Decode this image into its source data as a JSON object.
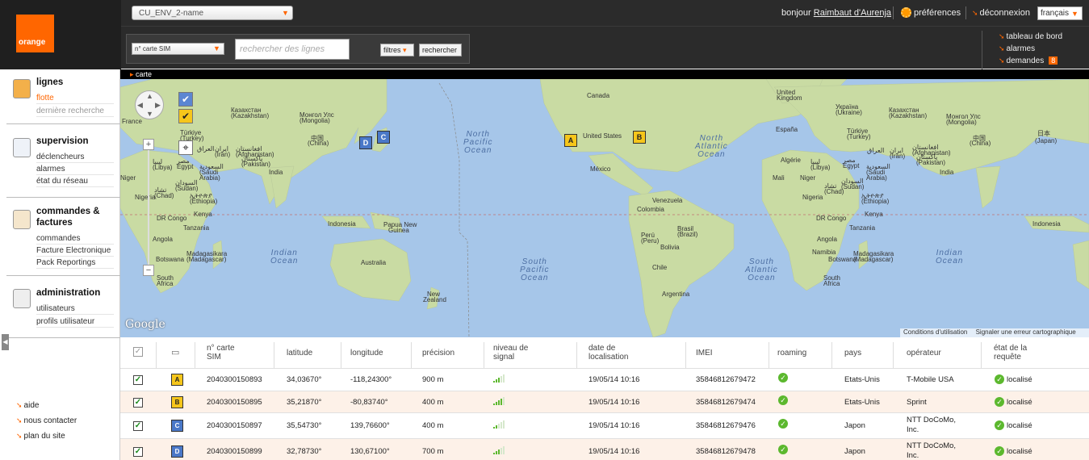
{
  "header": {
    "logo": "orange",
    "environment": "CU_ENV_2-name",
    "greeting_prefix": "bonjour",
    "user_name": "Raimbaut d'Aurenja",
    "preferences": "préférences",
    "logout": "déconnexion",
    "language": "français"
  },
  "search": {
    "field_select": "n° carte SIM",
    "placeholder": "rechercher des lignes",
    "filters_label": "filtres",
    "search_label": "rechercher"
  },
  "quicklinks": {
    "dashboard": "tableau de bord",
    "alarms": "alarmes",
    "requests": "demandes",
    "requests_count": "8"
  },
  "sidebar": {
    "sections": [
      {
        "title": "lignes",
        "items": [
          "flotte",
          "dernière recherche"
        ]
      },
      {
        "title": "supervision",
        "items": [
          "déclencheurs",
          "alarmes",
          "état du réseau"
        ]
      },
      {
        "title": "commandes &",
        "title2": "factures",
        "items": [
          "commandes",
          "Facture Electronique",
          "Pack Reportings"
        ]
      },
      {
        "title": "administration",
        "items": [
          "utilisateurs",
          "profils utilisateur"
        ]
      }
    ],
    "footer": [
      "aide",
      "nous contacter",
      "plan du site"
    ]
  },
  "breadcrumb": "carte",
  "map": {
    "google": "Google",
    "terms": "Conditions d'utilisation",
    "report": "Signaler une erreur cartographique",
    "labels": {
      "canada": "Canada",
      "us": "United States",
      "mexico": "México",
      "venezuela": "Venezuela",
      "colombia": "Colombia",
      "peru": "Perú",
      "peru2": "(Peru)",
      "brasil": "Brasil",
      "brasil2": "(Brazil)",
      "bolivia": "Bolivia",
      "chile": "Chile",
      "argentina": "Argentina",
      "uk": "United",
      "uk2": "Kingdom",
      "kazakh1": "Казахстан",
      "kazakh2": "(Kazakhstan)",
      "mongolia1": "Монгол Улс",
      "mongolia2": "(Mongolia)",
      "china1": "中国",
      "china2": "(China)",
      "japan1": "日本",
      "japan2": "(Japan)",
      "india": "India",
      "indonesia": "Indonesia",
      "png": "Papua New",
      "png2": "Guinea",
      "australia": "Australia",
      "nz": "New",
      "nz2": "Zealand",
      "turkey1": "Türkiye",
      "turkey2": "(Turkey)",
      "afghan1": "افغانستان",
      "afghan2": "(Afghanistan)",
      "pakistan1": "پاکستان",
      "pakistan2": "(Pakistan)",
      "iran1": "ایران",
      "iran2": "(Iran)",
      "iraq": "العراق",
      "egypt1": "مصر",
      "egypt2": "Egypt",
      "saudi1": "السعودية",
      "saudi2": "(Saudi",
      "saudi3": "Arabia)",
      "libya1": "ليبيا",
      "libya2": "(Libya)",
      "algeria": "Algérie",
      "mali": "Mali",
      "niger": "Niger",
      "nigeria": "Nigeria",
      "chad1": "تشاد",
      "chad2": "(Chad)",
      "sudan1": "السودان",
      "sudan2": "(Sudan)",
      "ethiopia1": "ኢትዮጵያ",
      "ethiopia2": "(Ethiopia)",
      "kenya": "Kenya",
      "drc": "DR Congo",
      "tanzania": "Tanzania",
      "angola": "Angola",
      "namibia": "Namibia",
      "botswana": "Botswana",
      "madagascar1": "Madagasikara",
      "madagascar2": "(Madagascar)",
      "sa1": "South",
      "sa2": "Africa",
      "france": "France",
      "ukraine1": "Україна",
      "ukraine2": "(Ukraine)",
      "spain": "España",
      "north_pacific": "North\nPacific\nOcean",
      "north_atlantic": "North\nAtlantic\nOcean",
      "south_pacific": "South\nPacific\nOcean",
      "south_atlantic": "South\nAtlantic\nOcean",
      "indian": "Indian\nOcean"
    },
    "pins": [
      "A",
      "B",
      "C",
      "D"
    ]
  },
  "table": {
    "headers": [
      "n° carte\nSIM",
      "latitude",
      "longitude",
      "précision",
      "niveau de\nsignal",
      "date de\nlocalisation",
      "IMEI",
      "roaming",
      "pays",
      "opérateur",
      "état de la\nrequête"
    ],
    "rows": [
      {
        "pin": "A",
        "color": "yellow",
        "sim": "2040300150893",
        "lat": "34,03670°",
        "lon": "-118,24300°",
        "precision": "900 m",
        "signal": 3,
        "date": "19/05/14 10:16",
        "imei": "35846812679472",
        "country": "Etats-Unis",
        "operator": "T-Mobile USA",
        "operator2": "",
        "status": "localisé"
      },
      {
        "pin": "B",
        "color": "yellow",
        "sim": "2040300150895",
        "lat": "35,21870°",
        "lon": "-80,83740°",
        "precision": "400 m",
        "signal": 4,
        "date": "19/05/14 10:16",
        "imei": "35846812679474",
        "country": "Etats-Unis",
        "operator": "Sprint",
        "operator2": "",
        "status": "localisé"
      },
      {
        "pin": "C",
        "color": "blue",
        "sim": "2040300150897",
        "lat": "35,54730°",
        "lon": "139,76600°",
        "precision": "400 m",
        "signal": 2,
        "date": "19/05/14 10:16",
        "imei": "35846812679476",
        "country": "Japon",
        "operator": "NTT DoCoMo,",
        "operator2": "Inc.",
        "status": "localisé"
      },
      {
        "pin": "D",
        "color": "blue",
        "sim": "2040300150899",
        "lat": "32,78730°",
        "lon": "130,67100°",
        "precision": "700 m",
        "signal": 3,
        "date": "19/05/14 10:16",
        "imei": "35846812679478",
        "country": "Japon",
        "operator": "NTT DoCoMo,",
        "operator2": "Inc.",
        "status": "localisé"
      }
    ]
  },
  "colors": {
    "brand": "#ff6600",
    "header": "#2b2b2b",
    "ocean": "#a6c6e9",
    "land": "#c8dca0",
    "ok": "#5cb82e"
  }
}
